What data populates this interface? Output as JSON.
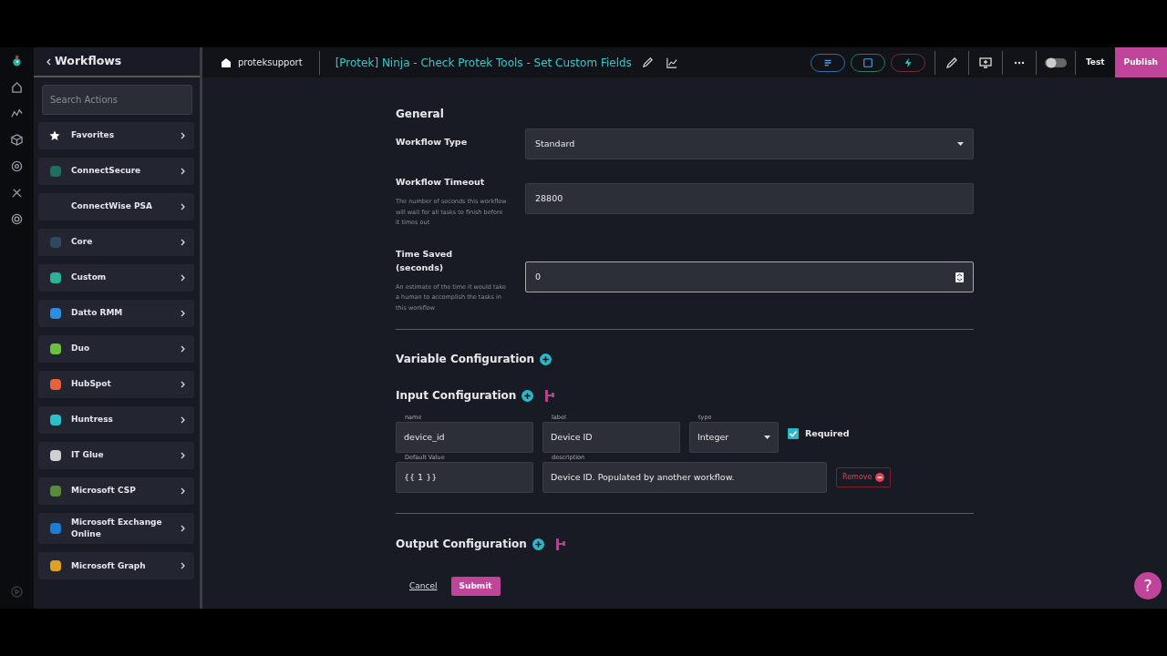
{
  "sidebar": {
    "back_label": "Workflows",
    "search": {
      "placeholder": "Search Actions"
    },
    "items": [
      {
        "label": "Favorites",
        "kind": "favorites"
      },
      {
        "label": "ConnectSecure",
        "color": "#1f6f5c"
      },
      {
        "label": "ConnectWise PSA"
      },
      {
        "label": "Core",
        "color": "#2e4a5e"
      },
      {
        "label": "Custom",
        "color": "#2bb39a"
      },
      {
        "label": "Datto RMM",
        "color": "#2a8fe0"
      },
      {
        "label": "Duo",
        "color": "#6dbf3f"
      },
      {
        "label": "HubSpot",
        "color": "#e8613c"
      },
      {
        "label": "Huntress",
        "color": "#2bbfc9"
      },
      {
        "label": "IT Glue",
        "color": "#d0d0d0"
      },
      {
        "label": "Microsoft CSP",
        "color": "#5a8a3a"
      },
      {
        "label": "Microsoft Exchange Online",
        "color": "#1f7bd6"
      },
      {
        "label": "Microsoft Graph",
        "color": "#e0a020"
      }
    ]
  },
  "header": {
    "org": "proteksupport",
    "title": "[Protek] Ninja - Check Protek Tools - Set Custom Fields",
    "test": "Test",
    "publish": "Publish",
    "toggle": {
      "on": false
    }
  },
  "general": {
    "heading": "General",
    "workflow_type": {
      "label": "Workflow Type",
      "value": "Standard"
    },
    "timeout": {
      "label": "Workflow Timeout",
      "help": "The number of seconds this workflow will wait for all tasks to finish before it times out",
      "value": "28800"
    },
    "time_saved": {
      "label": "Time Saved (seconds)",
      "help": "An estimate of the time it would take a human to accomplish the tasks in this workflow",
      "value": "0"
    }
  },
  "variable_configuration": {
    "heading": "Variable Configuration"
  },
  "input_configuration": {
    "heading": "Input Configuration",
    "inputs": [
      {
        "name_label": "name",
        "name": "device_id",
        "label_label": "label",
        "label": "Device ID",
        "type_label": "type",
        "type": "Integer",
        "required_label": "Required",
        "required": true,
        "default_label": "Default Value",
        "default": "{{ 1 }}",
        "description_label": "description",
        "description": "Device ID. Populated by another workflow.",
        "remove": "Remove"
      }
    ]
  },
  "output_configuration": {
    "heading": "Output Configuration"
  },
  "actions": {
    "cancel": "Cancel",
    "submit": "Submit"
  },
  "help_button": "?"
}
